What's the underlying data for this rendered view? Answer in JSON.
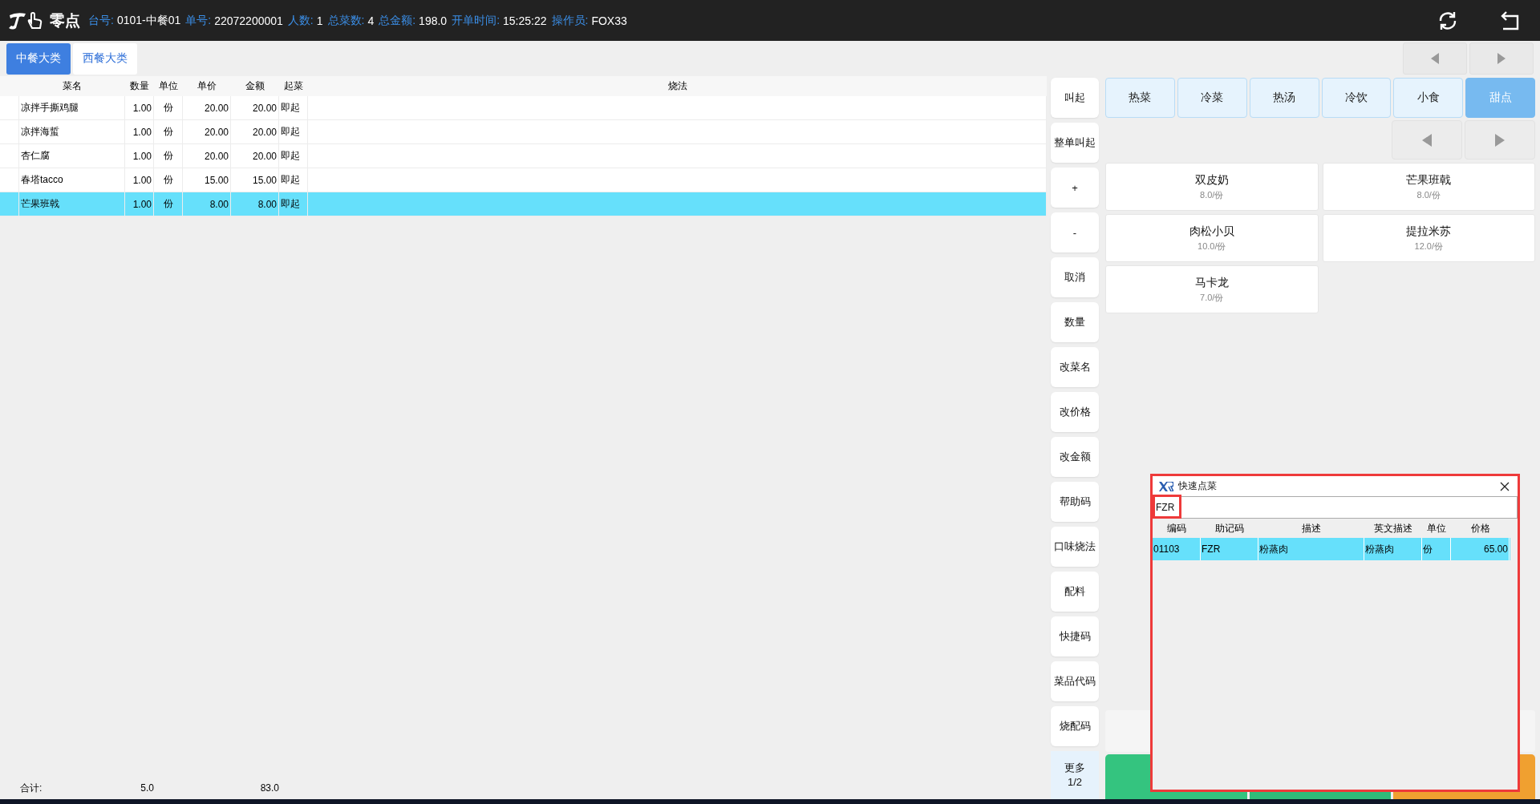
{
  "header": {
    "logo": "零点",
    "fields": [
      {
        "label": "台号:",
        "value": "0101-中餐01"
      },
      {
        "label": "单号:",
        "value": "22072200001"
      },
      {
        "label": "人数:",
        "value": "1"
      },
      {
        "label": "总菜数:",
        "value": "4"
      },
      {
        "label": "总金额:",
        "value": "198.0"
      },
      {
        "label": "开单时间:",
        "value": "15:25:22"
      },
      {
        "label": "操作员:",
        "value": "FOX33"
      }
    ]
  },
  "menu_tabs": [
    {
      "label": "中餐大类",
      "selected": true
    },
    {
      "label": "西餐大类",
      "selected": false
    }
  ],
  "order_table": {
    "columns": [
      "菜名",
      "数量",
      "单位",
      "单价",
      "金额",
      "起菜",
      "烧法"
    ],
    "rows": [
      {
        "cells": [
          "凉拌手撕鸡腿",
          "1.00",
          "份",
          "20.00",
          "20.00",
          "即起",
          ""
        ],
        "selected": false
      },
      {
        "cells": [
          "凉拌海蜇",
          "1.00",
          "份",
          "20.00",
          "20.00",
          "即起",
          ""
        ],
        "selected": false
      },
      {
        "cells": [
          "杏仁腐",
          "1.00",
          "份",
          "20.00",
          "20.00",
          "即起",
          ""
        ],
        "selected": false
      },
      {
        "cells": [
          "春塔tacco",
          "1.00",
          "份",
          "15.00",
          "15.00",
          "即起",
          ""
        ],
        "selected": false
      },
      {
        "cells": [
          "芒果班戟",
          "1.00",
          "份",
          "8.00",
          "8.00",
          "即起",
          ""
        ],
        "selected": true
      }
    ],
    "footer": {
      "label": "合计:",
      "quantity": "5.0",
      "amount": "83.0"
    }
  },
  "actions": [
    {
      "label": "叫起",
      "kind": "action"
    },
    {
      "label": "整单叫起",
      "kind": "action"
    },
    {
      "label": "+",
      "kind": "action"
    },
    {
      "label": "-",
      "kind": "action"
    },
    {
      "label": "取消",
      "kind": "action"
    },
    {
      "label": "数量",
      "kind": "action"
    },
    {
      "label": "改菜名",
      "kind": "action"
    },
    {
      "label": "改价格",
      "kind": "action"
    },
    {
      "label": "改金额",
      "kind": "action"
    },
    {
      "label": "帮助码",
      "kind": "action"
    },
    {
      "label": "口味烧法",
      "kind": "action"
    },
    {
      "label": "配料",
      "kind": "action"
    },
    {
      "label": "快捷码",
      "kind": "action"
    },
    {
      "label": "菜品代码",
      "kind": "action"
    },
    {
      "label": "烧配码",
      "kind": "action"
    },
    {
      "label": "更多\n1/2",
      "kind": "more"
    }
  ],
  "categories": [
    {
      "label": "热菜",
      "selected": false
    },
    {
      "label": "冷菜",
      "selected": false
    },
    {
      "label": "热汤",
      "selected": false
    },
    {
      "label": "冷饮",
      "selected": false
    },
    {
      "label": "小食",
      "selected": false
    },
    {
      "label": "甜点",
      "selected": true
    }
  ],
  "dishes": [
    {
      "name": "双皮奶",
      "price": "8.0/份"
    },
    {
      "name": "芒果班戟",
      "price": "8.0/份"
    },
    {
      "name": "肉松小贝",
      "price": "10.0/份"
    },
    {
      "name": "提拉米苏",
      "price": "12.0/份"
    },
    {
      "name": "马卡龙",
      "price": "7.0/份"
    }
  ],
  "bottom_buttons": [
    {
      "color": "#34c47f"
    },
    {
      "color": "#30bb79"
    },
    {
      "color": "#f0a030"
    }
  ],
  "quick_order_dialog": {
    "title": "快速点菜",
    "query": "FZR",
    "columns": [
      "编码",
      "助记码",
      "描述",
      "英文描述",
      "单位",
      "价格"
    ],
    "rows": [
      {
        "cells": [
          "01103",
          "FZR",
          "粉蒸肉",
          "粉蒸肉",
          "份",
          "65.00"
        ],
        "selected": true
      }
    ]
  }
}
